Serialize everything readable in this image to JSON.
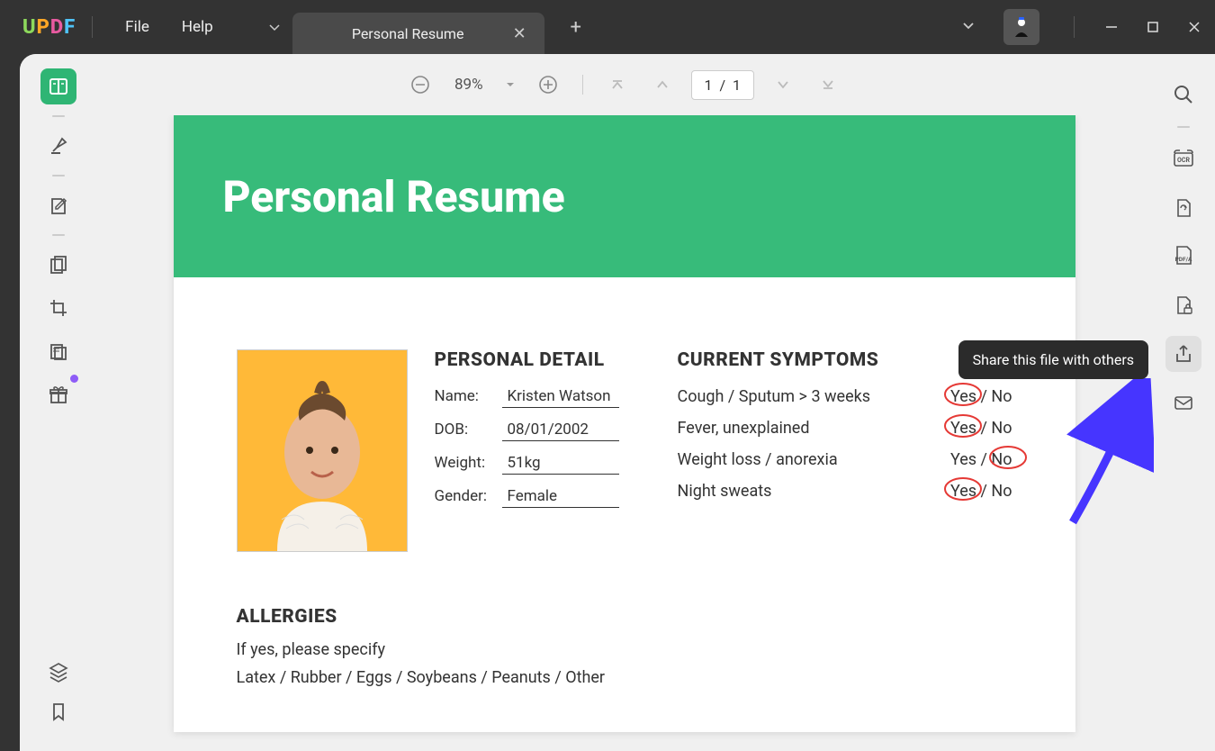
{
  "app": {
    "logo_u": "U",
    "logo_p": "P",
    "logo_d": "D",
    "logo_f": "F"
  },
  "menu": {
    "file": "File",
    "help": "Help"
  },
  "tabs": {
    "active_title": "Personal Resume"
  },
  "toolbar": {
    "zoom": "89%",
    "page_current": "1",
    "page_sep": "/",
    "page_total": "1"
  },
  "tooltip": {
    "share": "Share this file with others"
  },
  "document": {
    "title": "Personal Resume",
    "personal_detail": {
      "heading": "PERSONAL DETAIL",
      "name_label": "Name:",
      "name": "Kristen Watson",
      "dob_label": "DOB:",
      "dob": "08/01/2002",
      "weight_label": "Weight:",
      "weight": "51kg",
      "gender_label": "Gender:",
      "gender": "Female"
    },
    "symptoms": {
      "heading": "CURRENT SYMPTOMS",
      "rows": [
        {
          "label": "Cough / Sputum > 3 weeks",
          "answer": "Yes / No",
          "circled": "Yes"
        },
        {
          "label": "Fever, unexplained",
          "answer": "Yes / No",
          "circled": "Yes"
        },
        {
          "label": "Weight loss / anorexia",
          "answer": "Yes / No",
          "circled": "No"
        },
        {
          "label": "Night sweats",
          "answer": "Yes / No",
          "circled": "Yes"
        }
      ]
    },
    "allergies": {
      "heading": "ALLERGIES",
      "line1": "If yes, please specify",
      "line2": "Latex / Rubber / Eggs / Soybeans / Peanuts / Other"
    }
  }
}
